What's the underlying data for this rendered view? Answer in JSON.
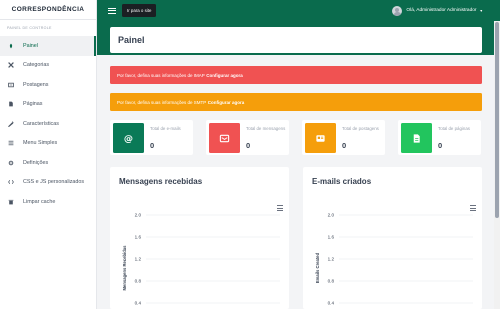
{
  "sidebar": {
    "brand": "CORRESPONDÊNCIA",
    "section": "PAINEL DE CONTROLE",
    "items": [
      {
        "label": "Painel",
        "icon": "dashboard-icon"
      },
      {
        "label": "Categorias",
        "icon": "categories-icon"
      },
      {
        "label": "Postagens",
        "icon": "posts-icon"
      },
      {
        "label": "Páginas",
        "icon": "pages-icon"
      },
      {
        "label": "Características",
        "icon": "features-icon"
      },
      {
        "label": "Menu Simples",
        "icon": "menu-icon"
      },
      {
        "label": "Definições",
        "icon": "settings-icon"
      },
      {
        "label": "CSS e JS personalizados",
        "icon": "code-icon"
      },
      {
        "label": "Limpar cache",
        "icon": "trash-icon"
      }
    ]
  },
  "topbar": {
    "site_button": "Ir para o site",
    "user_greeting": "Olá, Administrador Administrador"
  },
  "page": {
    "title": "Painel"
  },
  "alerts": {
    "imap": {
      "text": "Por favor, defina suas informações de IMAP",
      "link": "Configurar agora"
    },
    "smtp": {
      "text": "Por favor, defina suas informações de SMTP",
      "link": "Configurar agora"
    }
  },
  "stats": [
    {
      "label": "Total de e-mails",
      "value": "0",
      "color": "#0a7a57",
      "icon": "email-at-icon"
    },
    {
      "label": "Total de mensagens",
      "value": "0",
      "color": "#f05252",
      "icon": "messages-icon"
    },
    {
      "label": "Total de postagens",
      "value": "0",
      "color": "#f59e0b",
      "icon": "posts-icon"
    },
    {
      "label": "Total de páginas",
      "value": "0",
      "color": "#22c55e",
      "icon": "pages-icon"
    }
  ],
  "charts": [
    {
      "title": "Mensagens recebidas",
      "chart_data": {
        "type": "line",
        "ylabel": "Mensagens Recebidas",
        "yticks": [
          "2.0",
          "1.6",
          "1.2",
          "0.8",
          "0.4"
        ],
        "series": []
      }
    },
    {
      "title": "E-mails criados",
      "chart_data": {
        "type": "line",
        "ylabel": "Emails Created",
        "yticks": [
          "2.0",
          "1.6",
          "1.2",
          "0.8",
          "0.4"
        ],
        "series": []
      }
    }
  ],
  "colors": {
    "brand_green": "#0a6b4d",
    "alert_red": "#f05252",
    "alert_orange": "#f59e0b"
  }
}
